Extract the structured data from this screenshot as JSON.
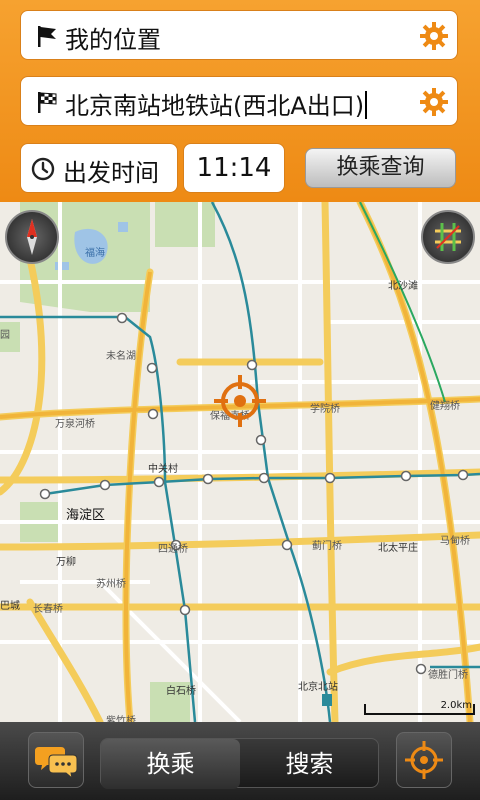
{
  "route": {
    "start_label": "我的位置",
    "end_label": "北京南站地铁站(西北A出口)",
    "depart_label": "出发时间",
    "depart_time": "11:14",
    "query_label": "换乘查询"
  },
  "map": {
    "labels": {
      "fuhai": "福海",
      "beishawa": "北沙滩",
      "weiminghu": "未名湖",
      "wanquanhe": "万泉河桥",
      "baofusi": "保福寺桥",
      "xueyuan": "学院桥",
      "jianxiang": "健翔桥",
      "zhongguancun": "中关村",
      "haidian": "海淀区",
      "wanliu": "万柳",
      "sitong": "四通桥",
      "jimen": "蓟门桥",
      "beitaiping": "北太平庄",
      "madian": "马甸桥",
      "suzhou": "苏州桥",
      "changchun": "长春桥",
      "cheng": "巴城",
      "yuan": "园",
      "baishi": "白石桥",
      "beijingbei": "北京北站",
      "zizhu": "紫竹桥",
      "deshengmen": "德胜门桥"
    },
    "scale": "2.0km"
  },
  "bottom": {
    "tab_transfer": "换乘",
    "tab_search": "搜索"
  }
}
